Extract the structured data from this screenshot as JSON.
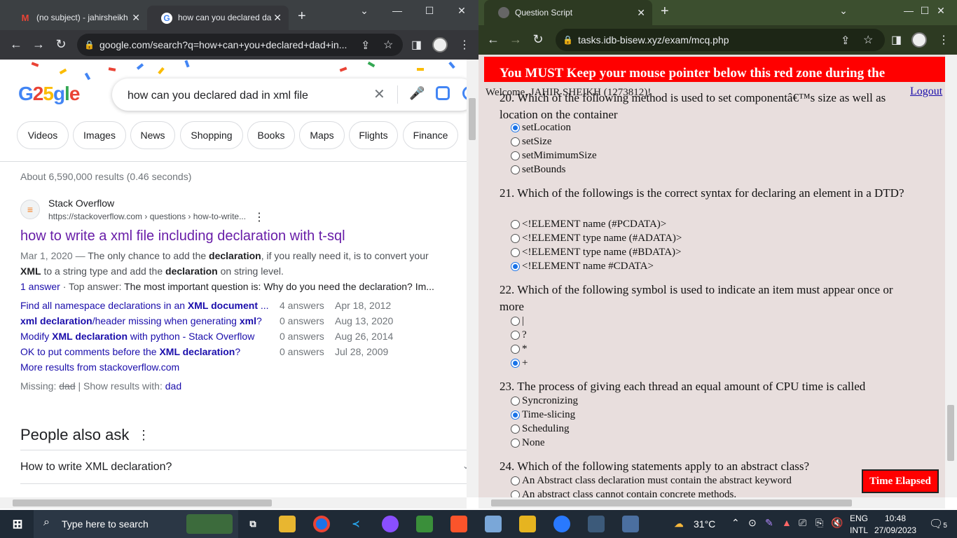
{
  "left_browser": {
    "tabs": [
      {
        "title": "(no subject) - jahirsheikh",
        "active": false
      },
      {
        "title": "how can you declared da",
        "active": true
      }
    ],
    "url": "google.com/search?q=how+can+you+declared+dad+in...",
    "page": {
      "logo_text": "G25gle",
      "query": "how can you declared dad in xml file",
      "chips": [
        "Videos",
        "Images",
        "News",
        "Shopping",
        "Books",
        "Maps",
        "Flights",
        "Finance"
      ],
      "results_stats": "About 6,590,000 results (0.46 seconds)",
      "result": {
        "site_name": "Stack Overflow",
        "site_url": "https://stackoverflow.com › questions › how-to-write...",
        "title": "how to write a xml file including declaration with t-sql",
        "snippet_date": "Mar 1, 2020 —",
        "snippet_1a": "The only chance to add the",
        "snippet_1b": "declaration",
        "snippet_1c": ", if you really need it, is to convert your",
        "snippet_2a": "XML",
        "snippet_2b": "to a string type and add the",
        "snippet_2c": "declaration",
        "snippet_2d": "on string level.",
        "answer_link": "1 answer",
        "top_answer_label": "· Top answer:",
        "top_answer_text": "The most important question is: Why do you need the declaration? Im...",
        "related": [
          {
            "a": "Find all namespace declarations in an ",
            "b": "XML document",
            "c": " ...",
            "answers": "4 answers",
            "date": "Apr 18, 2012"
          },
          {
            "a": "",
            "b": "xml declaration",
            "c": "/header missing when generating ",
            "d": "xml",
            "e": "?",
            "answers": "0 answers",
            "date": "Aug 13, 2020"
          },
          {
            "a": "Modify ",
            "b": "XML declaration",
            "c": " with python - Stack Overflow",
            "answers": "0 answers",
            "date": "Aug 26, 2014"
          },
          {
            "a": "OK to put comments before the ",
            "b": "XML declaration",
            "c": "?",
            "answers": "0 answers",
            "date": "Jul 28, 2009"
          }
        ],
        "more_results": "More results from stackoverflow.com",
        "missing_label": "Missing:",
        "missing_word": "dad",
        "show_results_label": "| Show results with:",
        "show_results_word": "dad"
      },
      "paa_title": "People also ask",
      "paa_items": [
        "How to write XML declaration?"
      ]
    }
  },
  "right_browser": {
    "tab_title": "Question Script",
    "url": "tasks.idb-bisew.xyz/exam/mcq.php",
    "page": {
      "warning": "You MUST Keep your mouse pointer below this red zone during the",
      "welcome": "Welcome, JAHIR SHEIKH (1273812)!",
      "logout": "Logout",
      "time_button": "Time Elapsed",
      "questions": [
        {
          "text": "20. Which of the following method is used to set componentâ€™s size as well as location on the container",
          "options": [
            "setLocation",
            "setSize",
            "setMimimumSize",
            "setBounds"
          ],
          "selected": 0
        },
        {
          "text": "21. Which of the followings is the correct syntax for declaring an element in a DTD?",
          "options": [
            "<!ELEMENT name (#PCDATA)>",
            "<!ELEMENT type name (#ADATA)>",
            "<!ELEMENT type name (#BDATA)>",
            "<!ELEMENT name #CDATA>"
          ],
          "selected": 3
        },
        {
          "text": "22. Which of the following symbol is used to indicate an item must appear once or more",
          "options": [
            "|",
            "?",
            "*",
            "+"
          ],
          "selected": 3
        },
        {
          "text": "23. The process of giving each thread an equal amount of CPU time is called",
          "options": [
            "Syncronizing",
            "Time-slicing",
            "Scheduling",
            "None"
          ],
          "selected": 1
        },
        {
          "text": "24. Which of the following statements apply to an abstract class?",
          "options": [
            "An Abstract class declaration must contain the abstract keyword",
            "An abstract class cannot contain concrete methods."
          ],
          "selected": -1
        }
      ]
    }
  },
  "taskbar": {
    "search_placeholder": "Type here to search",
    "temperature": "31°C",
    "lang_1": "ENG",
    "lang_2": "INTL",
    "time": "10:48",
    "date": "27/09/2023",
    "notifications": "5"
  },
  "colors": {
    "google_link": "#1a0dab",
    "visited_link": "#681da8",
    "exam_bg": "#e8dedd",
    "red_zone": "#ff0000"
  }
}
